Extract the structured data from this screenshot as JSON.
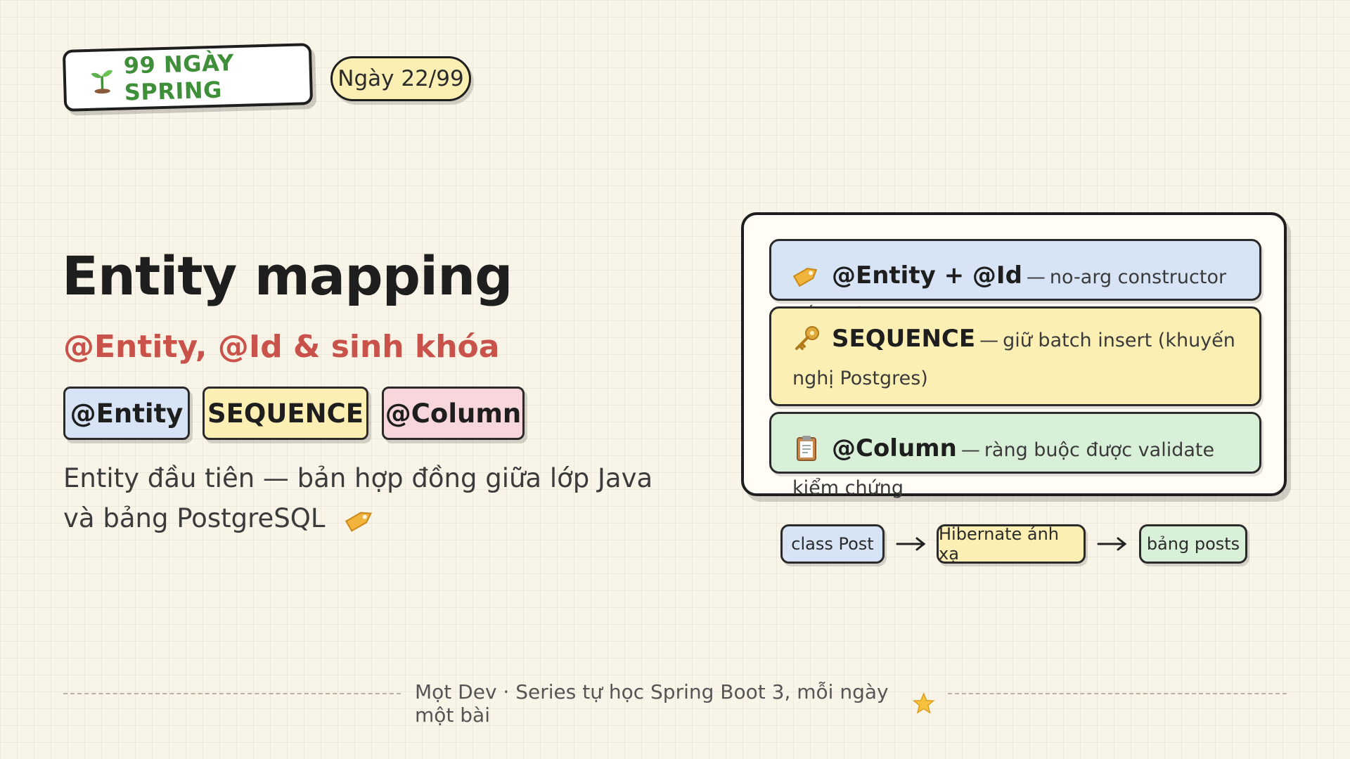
{
  "header": {
    "series_label": "99 NGÀY SPRING",
    "day_label": "Ngày 22/99",
    "sprout_icon": "seedling-icon"
  },
  "main": {
    "title": "Entity mapping",
    "subtitle": "@Entity, @Id & sinh khóa",
    "chips": [
      "@Entity",
      "SEQUENCE",
      "@Column"
    ],
    "description": "Entity đầu tiên — bản hợp đồng giữa lớp Java và bảng PostgreSQL",
    "description_icon": "tag-icon"
  },
  "card": {
    "rows": [
      {
        "icon": "tag-icon",
        "title": "@Entity + @Id",
        "sep": "—",
        "text": "no-arg constructor bắt buộc"
      },
      {
        "icon": "key-icon",
        "title": "SEQUENCE",
        "sep": "—",
        "text": "giữ batch insert (khuyến nghị Postgres)"
      },
      {
        "icon": "clipboard-icon",
        "title": "@Column",
        "sep": "—",
        "text": "ràng buộc được validate kiểm chứng"
      }
    ]
  },
  "flow": {
    "steps": [
      "class Post",
      "Hibernate ánh xạ",
      "bảng posts"
    ],
    "arrow_icon": "arrow-right-icon"
  },
  "footer": {
    "text": "Mọt Dev · Series tự học Spring Boot 3, mỗi ngày một bài",
    "icon": "star-icon"
  },
  "colors": {
    "background": "#f9f4e8",
    "accent_green": "#3f8f3a",
    "accent_red": "#c9524a",
    "blue": "#d6e4f5",
    "yellow": "#fcefb4",
    "pink": "#f8d7dc",
    "green": "#d9f0d8"
  }
}
